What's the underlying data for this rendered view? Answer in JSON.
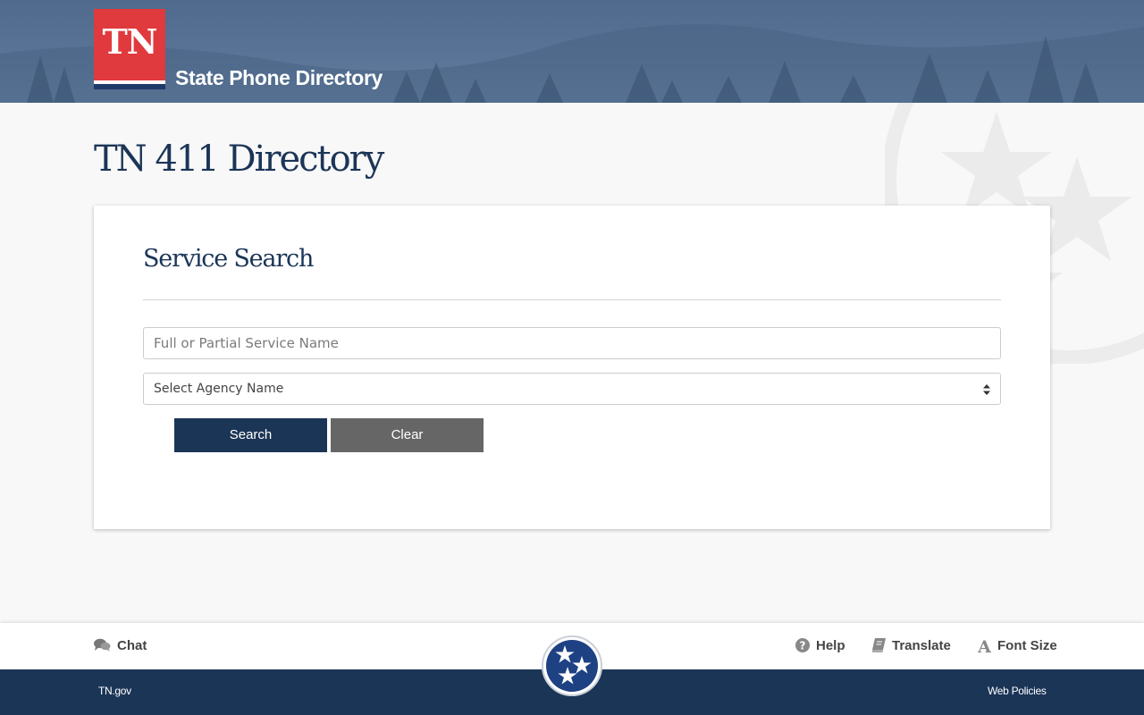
{
  "header": {
    "logo_text": "TN",
    "site_name": "State Phone Directory"
  },
  "page_title": "TN 411 Directory",
  "search_card": {
    "title": "Service Search",
    "service_input": {
      "value": "",
      "placeholder": "Full or Partial Service Name"
    },
    "agency_select": {
      "selected": "Select Agency Name"
    },
    "search_label": "Search",
    "clear_label": "Clear"
  },
  "footer": {
    "chat_label": "Chat",
    "help_label": "Help",
    "translate_label": "Translate",
    "font_size_label": "Font Size",
    "home_link": "TN.gov",
    "policies_link": "Web Policies"
  },
  "icons": {
    "chat": "chat-bubbles-icon",
    "help": "question-circle-icon",
    "translate": "book-icon",
    "font_size": "letter-a-icon",
    "seal": "tristar-icon"
  },
  "colors": {
    "navy": "#1b3557",
    "logo_red": "#e03a3e",
    "clear_gray": "#666666",
    "header_blue": "#56708f"
  }
}
